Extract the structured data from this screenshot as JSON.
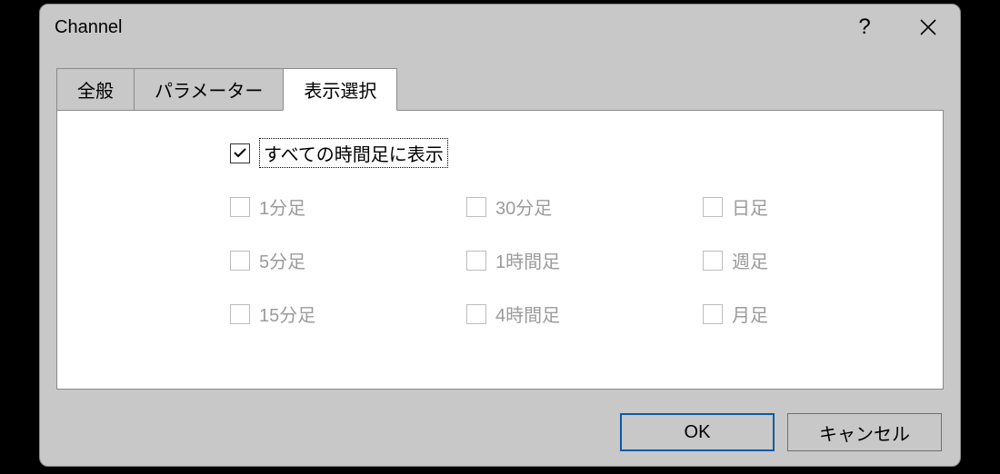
{
  "title": "Channel",
  "tabs": {
    "general": "全般",
    "parameters": "パラメーター",
    "display": "表示選択"
  },
  "master_checkbox": {
    "label": "すべての時間足に表示",
    "checked": true
  },
  "timeframes": {
    "m1": "1分足",
    "m5": "5分足",
    "m15": "15分足",
    "m30": "30分足",
    "h1": "1時間足",
    "h4": "4時間足",
    "d1": "日足",
    "w1": "週足",
    "mn": "月足"
  },
  "buttons": {
    "ok": "OK",
    "cancel": "キャンセル"
  },
  "help_symbol": "?"
}
